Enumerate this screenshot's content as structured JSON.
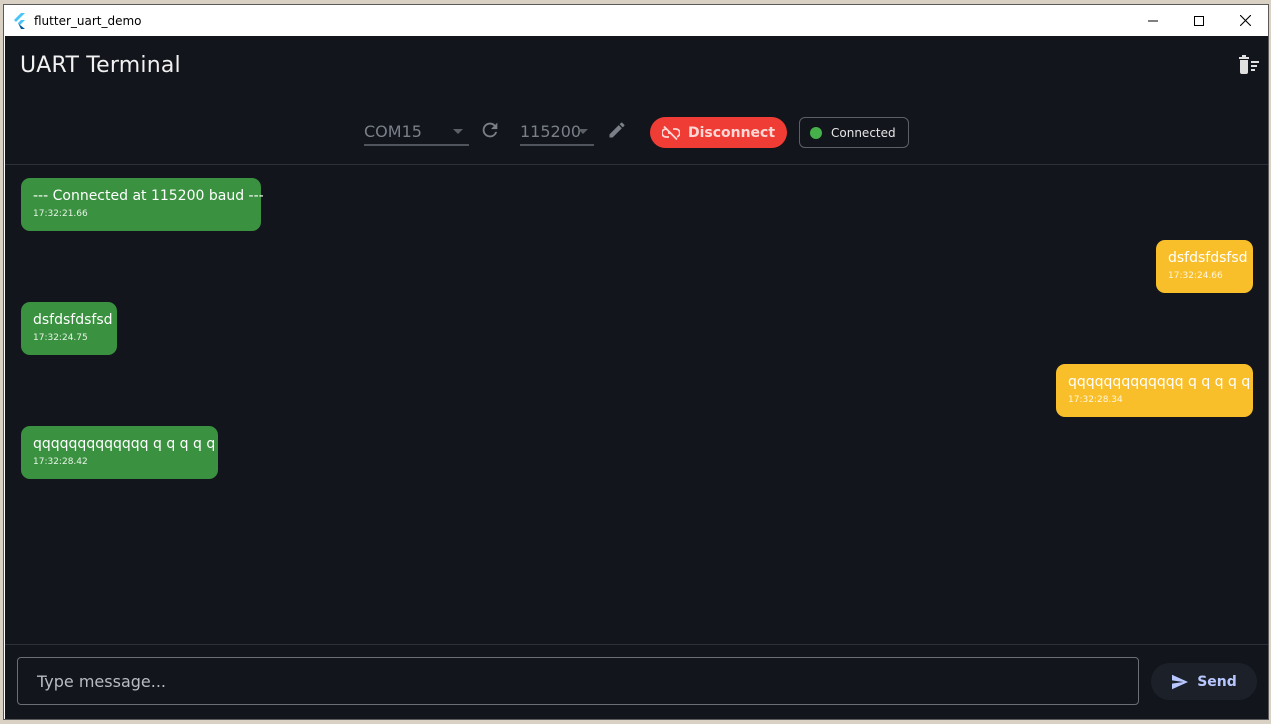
{
  "window": {
    "title": "flutter_uart_demo"
  },
  "appbar": {
    "title": "UART Terminal",
    "clear_icon": "delete-sweep-icon"
  },
  "controls": {
    "port": "COM15",
    "baud": "115200",
    "disconnect_label": "Disconnect",
    "status_label": "Connected",
    "status_color": "#46b04a"
  },
  "messages": [
    {
      "direction": "rx",
      "text": "--- Connected at 115200 baud ---",
      "time": "17:32:21.66"
    },
    {
      "direction": "tx",
      "text": "dsfdsfdsfsd",
      "time": "17:32:24.66"
    },
    {
      "direction": "rx",
      "text": "dsfdsfdsfsd",
      "time": "17:32:24.75"
    },
    {
      "direction": "tx",
      "text": "qqqqqqqqqqqqq q q q q q",
      "time": "17:32:28.34"
    },
    {
      "direction": "rx",
      "text": "qqqqqqqqqqqqq q q q q q",
      "time": "17:32:28.42"
    }
  ],
  "composer": {
    "placeholder": "Type message...",
    "send_label": "Send"
  },
  "colors": {
    "rx_bubble": "#3a9140",
    "tx_bubble": "#f8bf2a",
    "disconnect": "#ef3d36",
    "background": "#12151b"
  }
}
